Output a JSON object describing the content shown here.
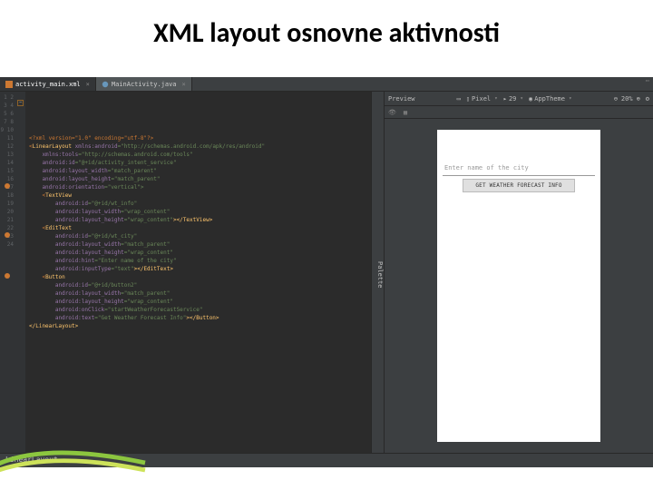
{
  "slide": {
    "title": "XML layout osnovne aktivnosti"
  },
  "tabs": {
    "active": {
      "label": "activity_main.xml"
    },
    "other": {
      "label": "MainActivity.java"
    }
  },
  "gutter_lines": "1\n2\n3\n4\n5\n6\n7\n8\n9\n10\n11\n12\n13\n14\n15\n16\n17\n18\n19\n20\n21\n22\n23\n24",
  "code": {
    "l1": "<?xml version=\"1.0\" encoding=\"utf-8\"?>",
    "l2a": "<",
    "l2b": "LinearLayout",
    "l2c": " xmlns:android",
    "l2d": "=\"http://schemas.android.com/apk/res/android\"",
    "l3a": "    xmlns:tools",
    "l3b": "=\"http://schemas.android.com/tools\"",
    "l4a": "    android:id",
    "l4b": "=\"@+id/activity_intent_service\"",
    "l5a": "    android:layout_width",
    "l5b": "=\"match_parent\"",
    "l6a": "    android:layout_height",
    "l6b": "=\"match_parent\"",
    "l7a": "    android:orientation",
    "l7b": "=\"vertical\">",
    "l8a": "    <",
    "l8b": "TextView",
    "l9a": "        android:id",
    "l9b": "=\"@+id/wt_info\"",
    "l10a": "        android:layout_width",
    "l10b": "=\"wrap_content\"",
    "l11a": "        android:layout_height",
    "l11b": "=\"wrap_content\"",
    "l11c": "></TextView>",
    "l12a": "    <",
    "l12b": "EditText",
    "l13a": "        android:id",
    "l13b": "=\"@+id/wt_city\"",
    "l14a": "        android:layout_width",
    "l14b": "=\"match_parent\"",
    "l15a": "        android:layout_height",
    "l15b": "=\"wrap_content\"",
    "l16a": "        android:hint",
    "l16b": "=\"Enter name of the city\"",
    "l17a": "        android:inputType",
    "l17b": "=\"text\"",
    "l17c": "></EditText>",
    "l18a": "    <",
    "l18b": "Button",
    "l19a": "        android:id",
    "l19b": "=\"@+id/button2\"",
    "l20a": "        android:layout_width",
    "l20b": "=\"match_parent\"",
    "l21a": "        android:layout_height",
    "l21b": "=\"wrap_content\"",
    "l22a": "        android:onClick",
    "l22b": "=\"startWeatherForecastService\"",
    "l23a": "        android:text",
    "l23b": "=\"Get Weather Forecast Info\"",
    "l23c": "></Button>",
    "l24": "</LinearLayout>"
  },
  "preview": {
    "title": "Preview",
    "device": "Pixel",
    "api": "29",
    "theme": "AppTheme",
    "zoom": "20%",
    "hint": "Enter name of the city",
    "button": "GET WEATHER FORECAST INFO"
  },
  "palette_label": "Palette",
  "status": {
    "breadcrumb": "LinearLayout"
  }
}
